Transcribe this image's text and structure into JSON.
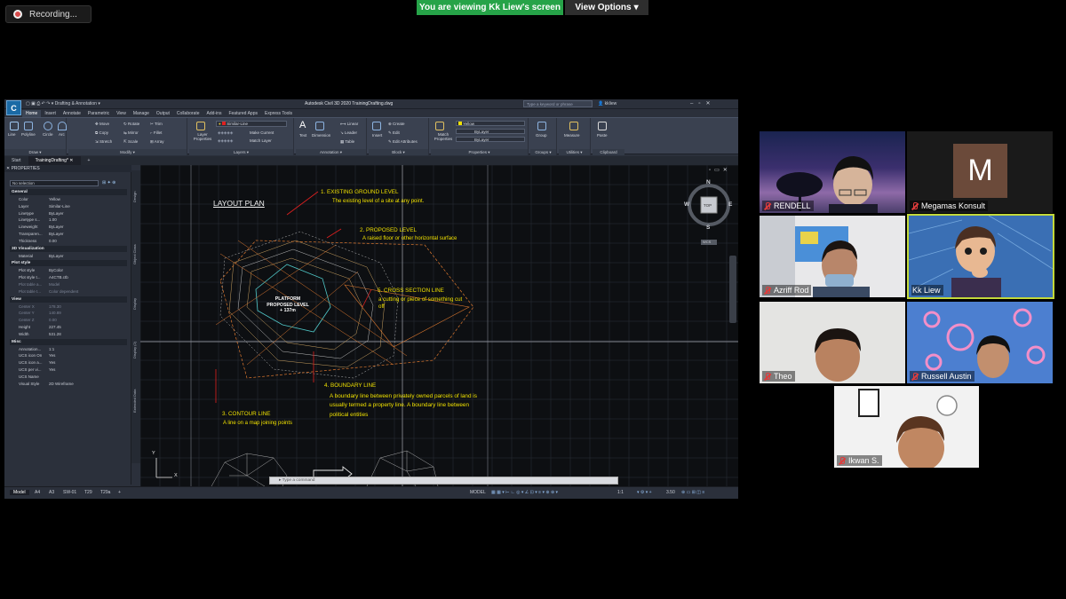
{
  "meeting": {
    "recording_label": "Recording...",
    "share_banner": "You are viewing Kk Liew's screen",
    "view_options_label": "View Options",
    "view_options_icon": "chevron-down-icon",
    "colors": {
      "banner_green": "#26a348",
      "active_speaker_border": "#c3d93a",
      "mute_red": "#e03c3c"
    }
  },
  "participants": [
    {
      "name": "RENDELL",
      "muted": true,
      "active": false
    },
    {
      "name": "Megamas Konsult",
      "muted": true,
      "active": false,
      "avatar_letter": "M",
      "avatar_color": "#6b4a3a"
    },
    {
      "name": "Azriff Rod",
      "muted": true,
      "active": false
    },
    {
      "name": "Kk Liew",
      "muted": false,
      "active": true
    },
    {
      "name": "Theo",
      "muted": true,
      "active": false
    },
    {
      "name": "Russell Austin",
      "muted": true,
      "active": false
    },
    {
      "name": "Ikwan S.",
      "muted": true,
      "active": false
    }
  ],
  "cad": {
    "window_title": "Autodesk Civil 3D 2020  TrainingDrafting.dwg",
    "workspace": "Drafting & Annotation",
    "search_placeholder": "Type a keyword or phrase",
    "user": "kkliew",
    "app_logo": "C",
    "ribbon_tabs": [
      "Home",
      "Insert",
      "Annotate",
      "Parametric",
      "View",
      "Manage",
      "Output",
      "Collaborate",
      "Add-ins",
      "Featured Apps",
      "Express Tools"
    ],
    "active_ribbon_tab": "Home",
    "panels": [
      {
        "title": "Draw",
        "tools": [
          "Line",
          "Polyline",
          "Circle",
          "Arc"
        ]
      },
      {
        "title": "Modify",
        "tools": [
          "Move",
          "Rotate",
          "Trim",
          "Copy",
          "Mirror",
          "Fillet",
          "Stretch",
          "Scale",
          "Array"
        ]
      },
      {
        "title": "Layers",
        "tools": [
          "Layer Properties",
          "Make Current",
          "Match Layer"
        ],
        "layer": "Similar-Line"
      },
      {
        "title": "Annotation",
        "tools": [
          "Text",
          "Dimension",
          "Linear",
          "Leader",
          "Table"
        ]
      },
      {
        "title": "Block",
        "tools": [
          "Insert",
          "Create",
          "Edit",
          "Edit Attributes"
        ]
      },
      {
        "title": "Properties",
        "tools": [
          "Match Properties"
        ],
        "color": "Yellow",
        "linetype": "ByLayer",
        "lineweight": "ByLayer"
      },
      {
        "title": "Groups",
        "tools": [
          "Group"
        ]
      },
      {
        "title": "Utilities",
        "tools": [
          "Measure"
        ]
      },
      {
        "title": "Clipboard",
        "tools": [
          "Paste"
        ]
      }
    ],
    "doc_tabs": [
      "Start",
      "TrainingDrafting*"
    ],
    "active_doc_tab": "TrainingDrafting*",
    "properties": {
      "header": "PROPERTIES",
      "selection": "No selection",
      "sections": [
        {
          "name": "General",
          "rows": [
            [
              "Color",
              "Yellow"
            ],
            [
              "Layer",
              "Similar-Line"
            ],
            [
              "Linetype",
              "ByLayer"
            ],
            [
              "Linetype s...",
              "1.00"
            ],
            [
              "Lineweight",
              "ByLayer"
            ],
            [
              "Transparen...",
              "ByLayer"
            ],
            [
              "Thickness",
              "0.00"
            ]
          ]
        },
        {
          "name": "3D Visualization",
          "rows": [
            [
              "Material",
              "ByLayer"
            ]
          ]
        },
        {
          "name": "Plot style",
          "rows": [
            [
              "Plot style",
              "ByColor"
            ],
            [
              "Plot style t...",
              "A4CTB.ctb"
            ],
            [
              "Plot table a...",
              "Model"
            ],
            [
              "Plot table t...",
              "Color dependent"
            ]
          ]
        },
        {
          "name": "View",
          "rows": [
            [
              "Center X",
              "178.30"
            ],
            [
              "Center Y",
              "140.89"
            ],
            [
              "Center Z",
              "0.00"
            ],
            [
              "Height",
              "227.45"
            ],
            [
              "Width",
              "531.28"
            ]
          ]
        },
        {
          "name": "Misc",
          "rows": [
            [
              "Annotation...",
              "1:1"
            ],
            [
              "UCS icon On",
              "Yes"
            ],
            [
              "UCS icon a...",
              "Yes"
            ],
            [
              "UCS per vi...",
              "Yes"
            ],
            [
              "UCS Name",
              ""
            ],
            [
              "Visual Style",
              "2D Wireframe"
            ]
          ]
        }
      ]
    },
    "side_tabs": [
      "Design",
      "Object Class",
      "Display",
      "Display (2)",
      "Extended Data"
    ],
    "drawing": {
      "title": "LAYOUT PLAN",
      "annotations": [
        {
          "heading": "1.   EXISTING GROUND LEVEL",
          "text": "The existing level of a site at any point."
        },
        {
          "heading": "2. PROPOSED LEVEL",
          "text": "A raised floor or other horizontal surface"
        },
        {
          "heading": "5. CROSS SECTION LINE",
          "text": "a cutting or piece of something cut off"
        },
        {
          "heading": "4. BOUNDARY LINE",
          "text": "A boundary line between privately owned parcels of land is usually termed a property line. A boundary line between political entities"
        },
        {
          "heading": "3. CONTOUR LINE",
          "text": "A line on a map joining points"
        }
      ],
      "platform_label": "PLATFORM",
      "platform_sublabel": "PROPOSED LEVEL",
      "platform_level": "+ 137m",
      "compass": {
        "n": "N",
        "s": "S",
        "e": "E",
        "w": "W",
        "top": "TOP",
        "wcs": "WCS"
      },
      "ucs": {
        "x": "X",
        "y": "Y"
      },
      "annotation_color": "#f0e100",
      "marker_color": "#e02020"
    },
    "command_placeholder": "Type a command",
    "layout_tabs": [
      "Model",
      "A4",
      "A3",
      "SW-01",
      "T29",
      "T29a"
    ],
    "active_layout_tab": "Model",
    "status": {
      "mode": "MODEL",
      "scale": "1:1",
      "value": "3.50"
    }
  }
}
